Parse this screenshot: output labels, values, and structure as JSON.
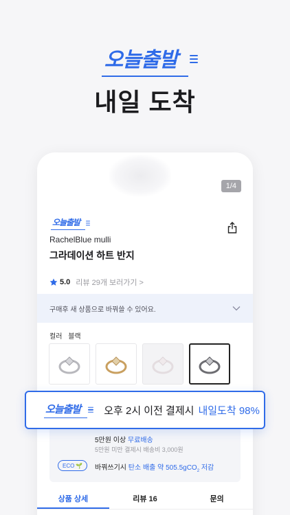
{
  "promo": {
    "logo_text": "오늘출발",
    "title": "내일 도착"
  },
  "product": {
    "image_counter": "1/4",
    "badge": "오늘출발",
    "brand": "RachelBlue mulli",
    "name": "그라데이션 하트 반지",
    "rating": "5.0",
    "review_link": "리뷰 29개 보러가기 >",
    "exchange_notice": "구매후 새 상품으로 바꿔쓸 수 있어요.",
    "color_label": "컬러",
    "color_value": "블랙",
    "swatches": [
      {
        "name": "silver",
        "color": "#b8b8bd"
      },
      {
        "name": "gold",
        "color": "#c9a060"
      },
      {
        "name": "light",
        "color": "#e4dde0"
      },
      {
        "name": "black",
        "color": "#6d6d72"
      }
    ]
  },
  "shipping": {
    "free_prefix": "5만원 이상",
    "free_label": "무료배송",
    "note": "5만원 미만 결제시 배송비 3,000원",
    "eco_badge": "ECO",
    "eco_prefix": "바꿔쓰기시",
    "eco_highlight": "탄소 배출 약 505.5gCO",
    "eco_sub": "2",
    "eco_suffix": " 저감"
  },
  "tabs": [
    {
      "label": "상품 상세",
      "active": true
    },
    {
      "label": "리뷰 16",
      "active": false
    },
    {
      "label": "문의",
      "active": false
    }
  ],
  "callout": {
    "badge": "오늘출발",
    "text": "오후 2시 이전 결제시",
    "highlight": "내일도착 98%"
  },
  "colors": {
    "accent": "#2f6be8",
    "background": "#f6f6f8",
    "eco_leaf": "#32b05c"
  }
}
